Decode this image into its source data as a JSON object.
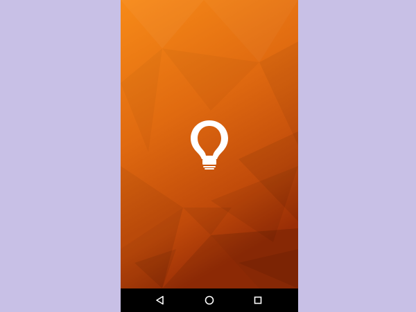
{
  "app": {
    "screen": "splash",
    "logo_icon": "lightbulb-icon"
  },
  "colors": {
    "backdrop": "#c8c0e6",
    "splash_top": "#f5881a",
    "splash_bottom": "#9a2c06",
    "logo": "#ffffff",
    "navbar": "#000000",
    "nav_icon": "#ffffff"
  },
  "navigation_bar": {
    "buttons": [
      {
        "id": "back",
        "icon": "back-triangle-icon"
      },
      {
        "id": "home",
        "icon": "home-circle-icon"
      },
      {
        "id": "recents",
        "icon": "recents-square-icon"
      }
    ]
  }
}
